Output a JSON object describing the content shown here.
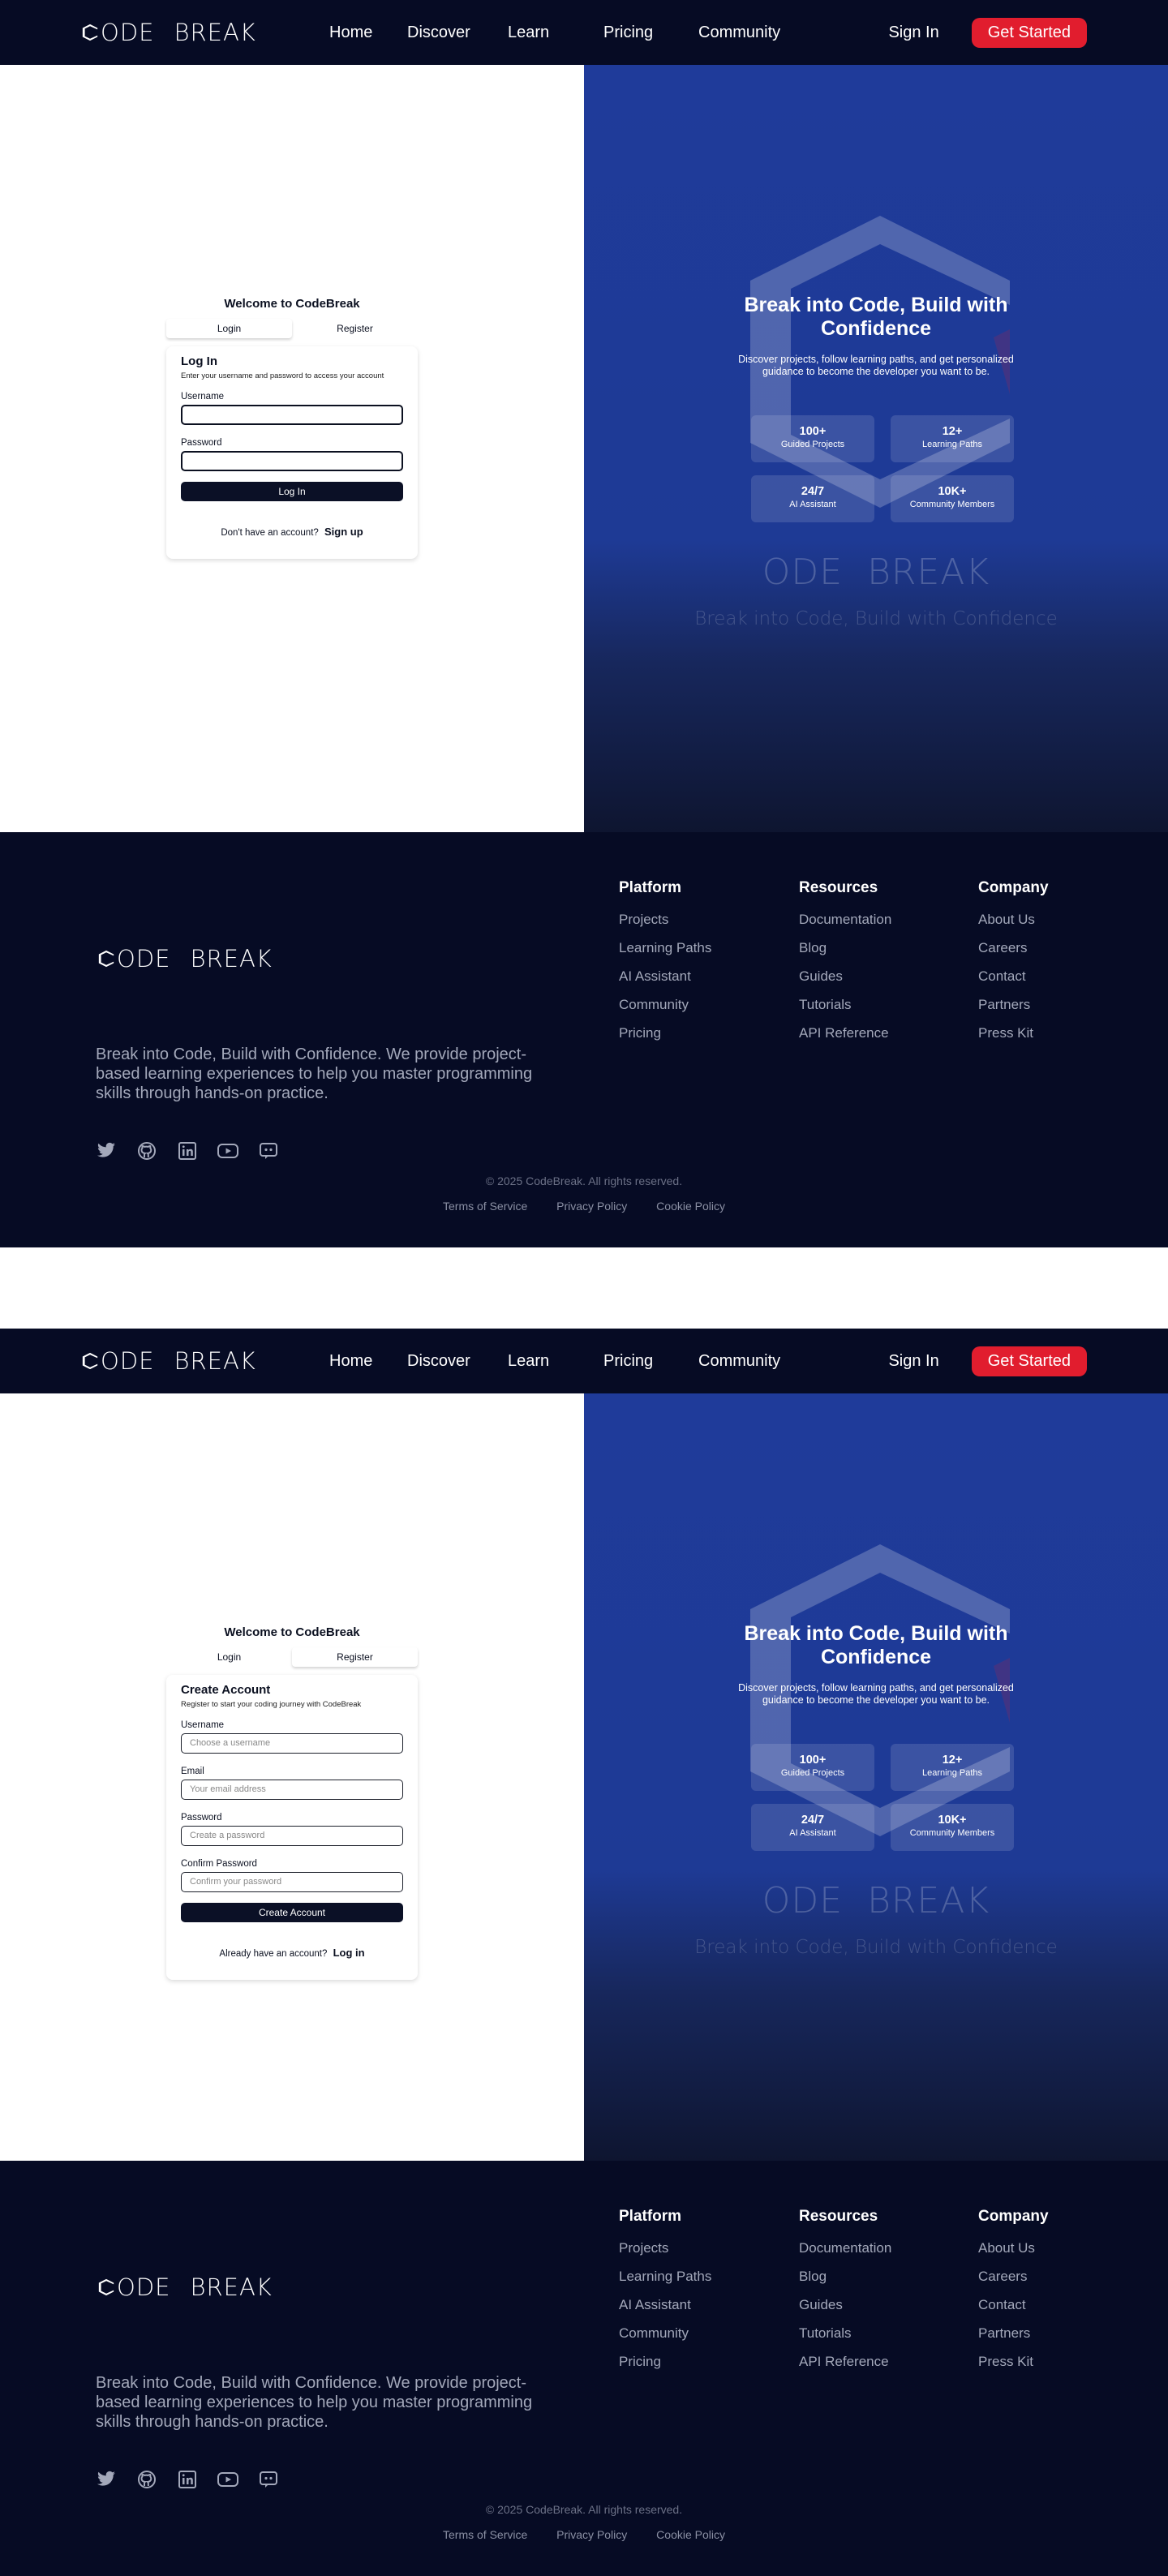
{
  "brand": {
    "logo_left": "ODE",
    "logo_right": "BREAK",
    "accent": "#e11d2e",
    "nav_bg": "#060b24",
    "hero_blue": "#1f3b9a"
  },
  "nav": {
    "links": [
      "Home",
      "Discover",
      "Learn",
      "Pricing",
      "Community"
    ],
    "sign_in": "Sign In",
    "get_started": "Get Started"
  },
  "auth": {
    "welcome": "Welcome to CodeBreak",
    "tab_login": "Login",
    "tab_register": "Register"
  },
  "login_form": {
    "title": "Log In",
    "subtitle": "Enter your username and password to access your account",
    "username_label": "Username",
    "password_label": "Password",
    "submit": "Log In",
    "switch_text": "Don't have an account?",
    "switch_link": "Sign up"
  },
  "register_form": {
    "title": "Create Account",
    "subtitle": "Register to start your coding journey with CodeBreak",
    "username_label": "Username",
    "username_placeholder": "Choose a username",
    "email_label": "Email",
    "email_placeholder": "Your email address",
    "password_label": "Password",
    "password_placeholder": "Create a password",
    "confirm_label": "Confirm Password",
    "confirm_placeholder": "Confirm your password",
    "submit": "Create Account",
    "switch_text": "Already have an account?",
    "switch_link": "Log in"
  },
  "hero": {
    "title_line1": "Break into Code, Build with",
    "title_line2": "Confidence",
    "description": "Discover projects, follow learning paths, and get personalized guidance to become the developer you want to be.",
    "stats": [
      {
        "value": "100+",
        "label": "Guided Projects"
      },
      {
        "value": "12+",
        "label": "Learning Paths"
      },
      {
        "value": "24/7",
        "label": "AI Assistant"
      },
      {
        "value": "10K+",
        "label": "Community Members"
      }
    ],
    "faint_tagline": "Break into Code, Build with Confidence"
  },
  "footer": {
    "description": "Break into Code, Build with Confidence. We provide project-based learning experiences to help you master programming skills through hands-on practice.",
    "columns": [
      {
        "title": "Platform",
        "items": [
          "Projects",
          "Learning Paths",
          "AI Assistant",
          "Community",
          "Pricing"
        ]
      },
      {
        "title": "Resources",
        "items": [
          "Documentation",
          "Blog",
          "Guides",
          "Tutorials",
          "API Reference"
        ]
      },
      {
        "title": "Company",
        "items": [
          "About Us",
          "Careers",
          "Contact",
          "Partners",
          "Press Kit"
        ]
      }
    ],
    "socials": [
      "twitter-icon",
      "github-icon",
      "linkedin-icon",
      "youtube-icon",
      "discord-icon"
    ],
    "copyright": "© 2025 CodeBreak. All rights reserved.",
    "legal": [
      "Terms of Service",
      "Privacy Policy",
      "Cookie Policy"
    ]
  }
}
